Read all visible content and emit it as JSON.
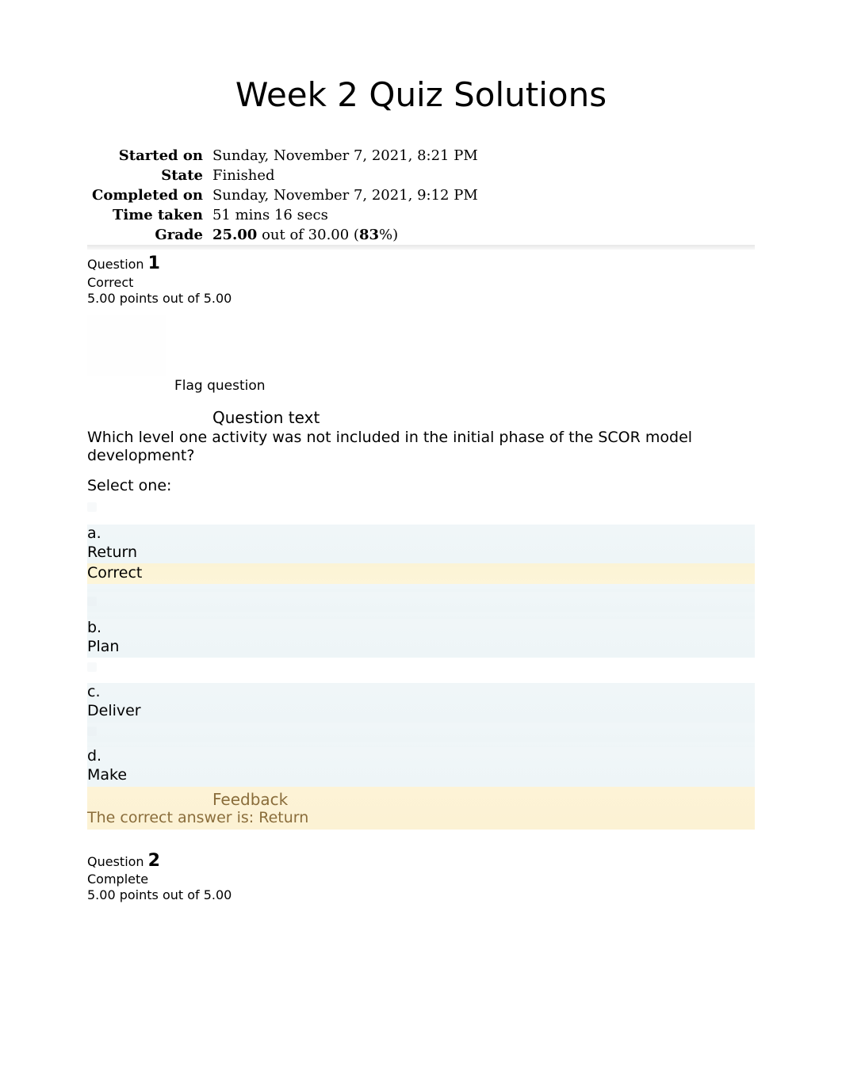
{
  "title": "Week 2 Quiz Solutions",
  "summary": {
    "rows": [
      {
        "label": "Started on",
        "value": "Sunday, November 7, 2021, 8:21 PM"
      },
      {
        "label": "State",
        "value": "Finished"
      },
      {
        "label": "Completed on",
        "value": "Sunday, November 7, 2021, 9:12 PM"
      },
      {
        "label": "Time taken",
        "value": "51 mins 16 secs"
      }
    ],
    "grade_label": "Grade",
    "grade_score": "25.00",
    "grade_mid": " out of 30.00 (",
    "grade_pct": "83",
    "grade_tail": "%)"
  },
  "q1": {
    "label": "Question ",
    "number": "1",
    "status": "Correct",
    "points": "5.00 points out of 5.00",
    "flag": "Flag question",
    "qtext_head": "Question text",
    "qtext_body": "Which level one activity was not included in the initial phase of the SCOR model development?",
    "select_one": "Select one:",
    "opts": {
      "a_letter": "a.",
      "a_text": "Return",
      "a_correct": "Correct",
      "b_letter": "b.",
      "b_text": "Plan",
      "c_letter": "c.",
      "c_text": "Deliver",
      "d_letter": "d.",
      "d_text": "Make"
    },
    "feedback_head": "Feedback",
    "feedback_body": "The correct answer is: Return"
  },
  "q2": {
    "label": "Question ",
    "number": "2",
    "status": "Complete",
    "points": "5.00 points out of 5.00"
  }
}
